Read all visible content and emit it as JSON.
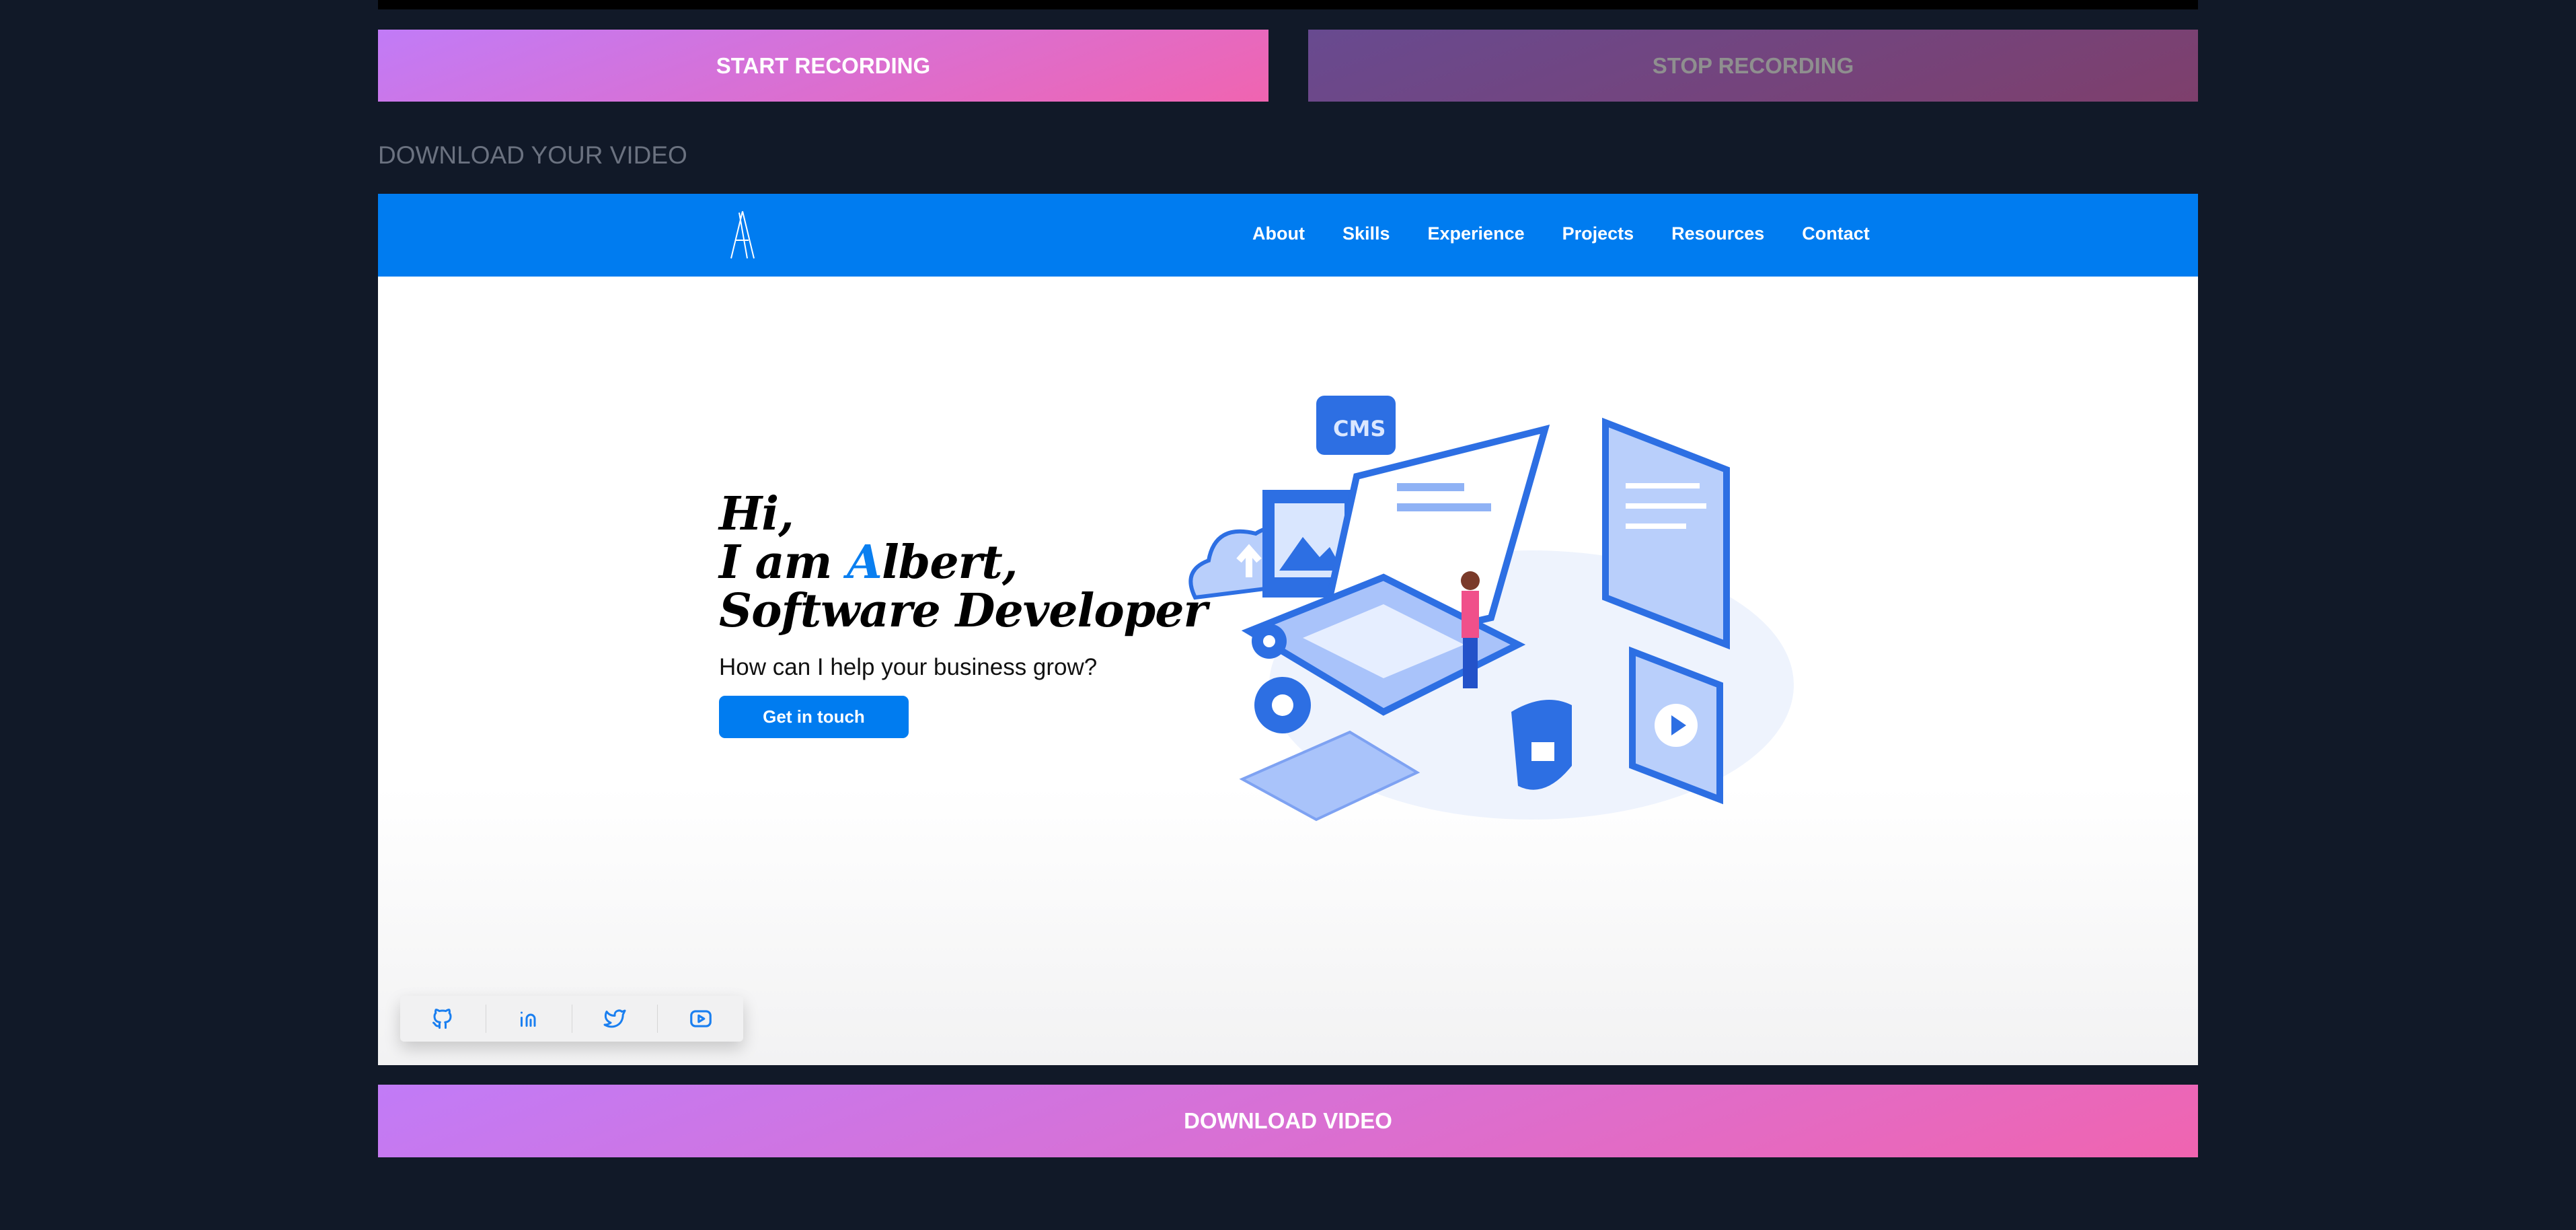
{
  "controls": {
    "start_label": "START RECORDING",
    "stop_label": "STOP RECORDING",
    "download_heading": "DOWNLOAD YOUR VIDEO",
    "download_label": "DOWNLOAD VIDEO"
  },
  "site": {
    "logo_letter": "A",
    "nav": [
      "About",
      "Skills",
      "Experience",
      "Projects",
      "Resources",
      "Contact"
    ],
    "hero": {
      "line1": "Hi,",
      "line2_prefix": "I am ",
      "name_initial": "A",
      "name_rest": "lbert,",
      "line3": "Software Developer",
      "subtitle": "How can I help your business grow?",
      "cta": "Get in touch"
    },
    "illustration_label": "CMS",
    "social": [
      "github-icon",
      "linkedin-icon",
      "twitter-icon",
      "youtube-icon"
    ]
  },
  "colors": {
    "accent": "#007cf0",
    "gradient_start": "#c17bf7",
    "gradient_end": "#f064b0",
    "background": "#111928"
  }
}
